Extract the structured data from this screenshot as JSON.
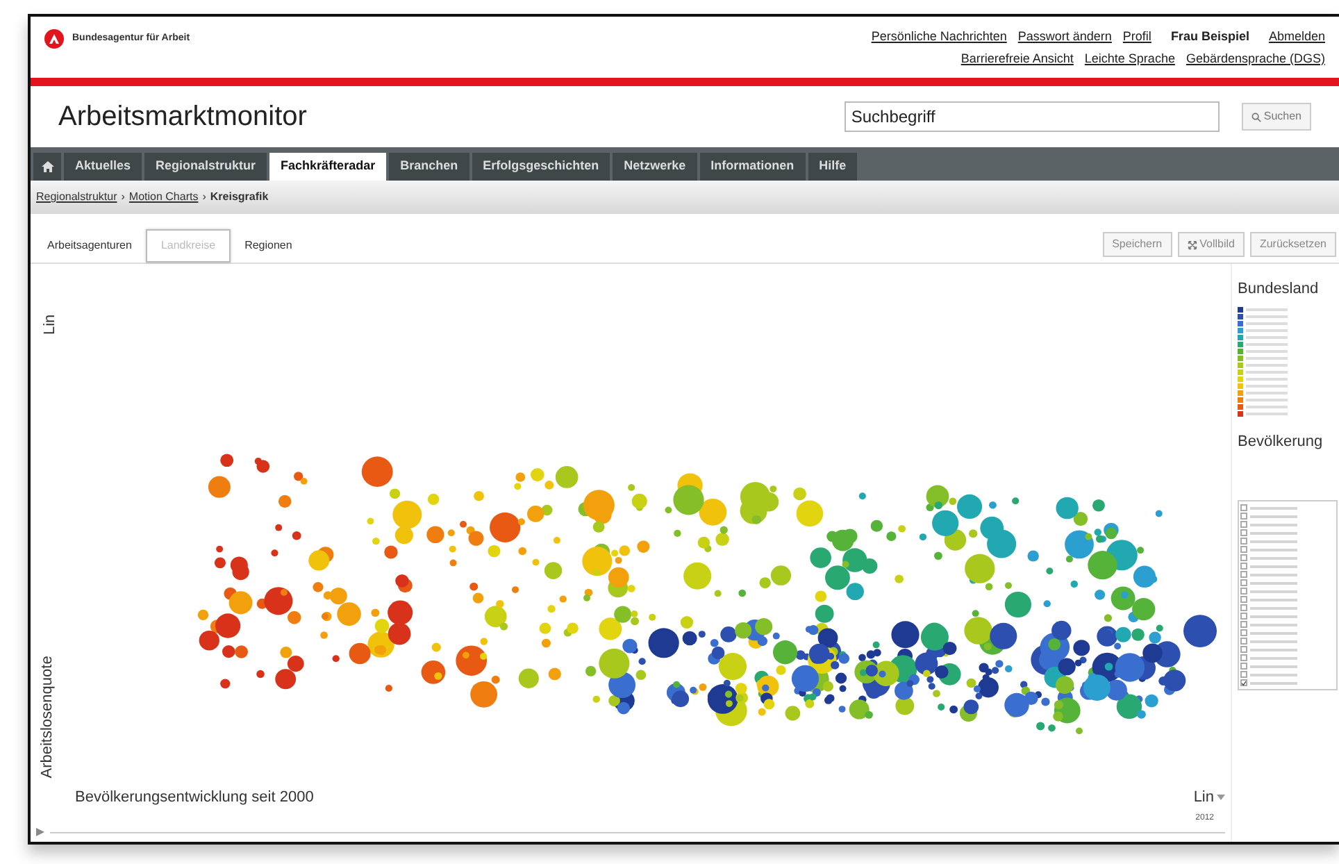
{
  "header": {
    "logo_text": "Bundesagentur für Arbeit",
    "links": [
      "Persönliche Nachrichten",
      "Passwort ändern",
      "Profil"
    ],
    "user": "Frau Beispiel",
    "logout": "Abmelden",
    "accessibility_links": [
      "Barrierefreie Ansicht",
      "Leichte Sprache",
      "Gebärdensprache (DGS)"
    ]
  },
  "site_title": "Arbeitsmarktmonitor",
  "search": {
    "value": "Suchbegriff",
    "button": "Suchen"
  },
  "nav": [
    {
      "kind": "home",
      "selected": false
    },
    {
      "kind": "link",
      "label": "Aktuelles",
      "selected": false
    },
    {
      "kind": "link",
      "label": "Regionalstruktur",
      "selected": false
    },
    {
      "kind": "link",
      "label": "Fachkräfteradar",
      "selected": true
    },
    {
      "kind": "link",
      "label": "Branchen",
      "selected": false
    },
    {
      "kind": "link",
      "label": "Erfolgsgeschichten",
      "selected": false
    },
    {
      "kind": "link",
      "label": "Netzwerke",
      "selected": false
    },
    {
      "kind": "link",
      "label": "Informationen",
      "selected": false
    },
    {
      "kind": "link",
      "label": "Hilfe",
      "selected": false
    }
  ],
  "breadcrumb": {
    "items": [
      "Regionalstruktur",
      "Motion Charts",
      "Kreisgrafik"
    ],
    "separator": "›"
  },
  "view_tabs": [
    {
      "label": "Arbeitsagenturen",
      "selected": false
    },
    {
      "label": "Landkreise",
      "selected": true
    },
    {
      "label": "Regionen",
      "selected": false
    }
  ],
  "toolbar": [
    "Speichern",
    "Vollbild",
    "Zurücksetzen"
  ],
  "chart": {
    "y_scale": "Lin",
    "y_label": "Arbeitslosenquote",
    "x_label": "Bevölkerungsentwicklung seit 2000",
    "x_scale": "Lin",
    "year": "2012"
  },
  "legend": {
    "title": "Bundesland",
    "items": [
      {
        "color": "#1f3a93"
      },
      {
        "color": "#2c4fb0"
      },
      {
        "color": "#3a6fcf"
      },
      {
        "color": "#2a9fd0"
      },
      {
        "color": "#22a8b0"
      },
      {
        "color": "#2aa872"
      },
      {
        "color": "#56b33a"
      },
      {
        "color": "#84bf2a"
      },
      {
        "color": "#a8c81e"
      },
      {
        "color": "#c9d115"
      },
      {
        "color": "#e2d40e"
      },
      {
        "color": "#f0c20c"
      },
      {
        "color": "#f2a10c"
      },
      {
        "color": "#ef7d10"
      },
      {
        "color": "#e85a14"
      },
      {
        "color": "#d9321a"
      }
    ]
  },
  "size_title": "Bevölkerung",
  "region_list": [
    {
      "checked": false
    },
    {
      "checked": false
    },
    {
      "checked": false
    },
    {
      "checked": false
    },
    {
      "checked": false
    },
    {
      "checked": false
    },
    {
      "checked": false
    },
    {
      "checked": false
    },
    {
      "checked": false
    },
    {
      "checked": false
    },
    {
      "checked": false
    },
    {
      "checked": false
    },
    {
      "checked": false
    },
    {
      "checked": false
    },
    {
      "checked": false
    },
    {
      "checked": false
    },
    {
      "checked": false
    },
    {
      "checked": false
    },
    {
      "checked": false
    },
    {
      "checked": false
    },
    {
      "checked": false
    },
    {
      "checked": true
    }
  ]
}
